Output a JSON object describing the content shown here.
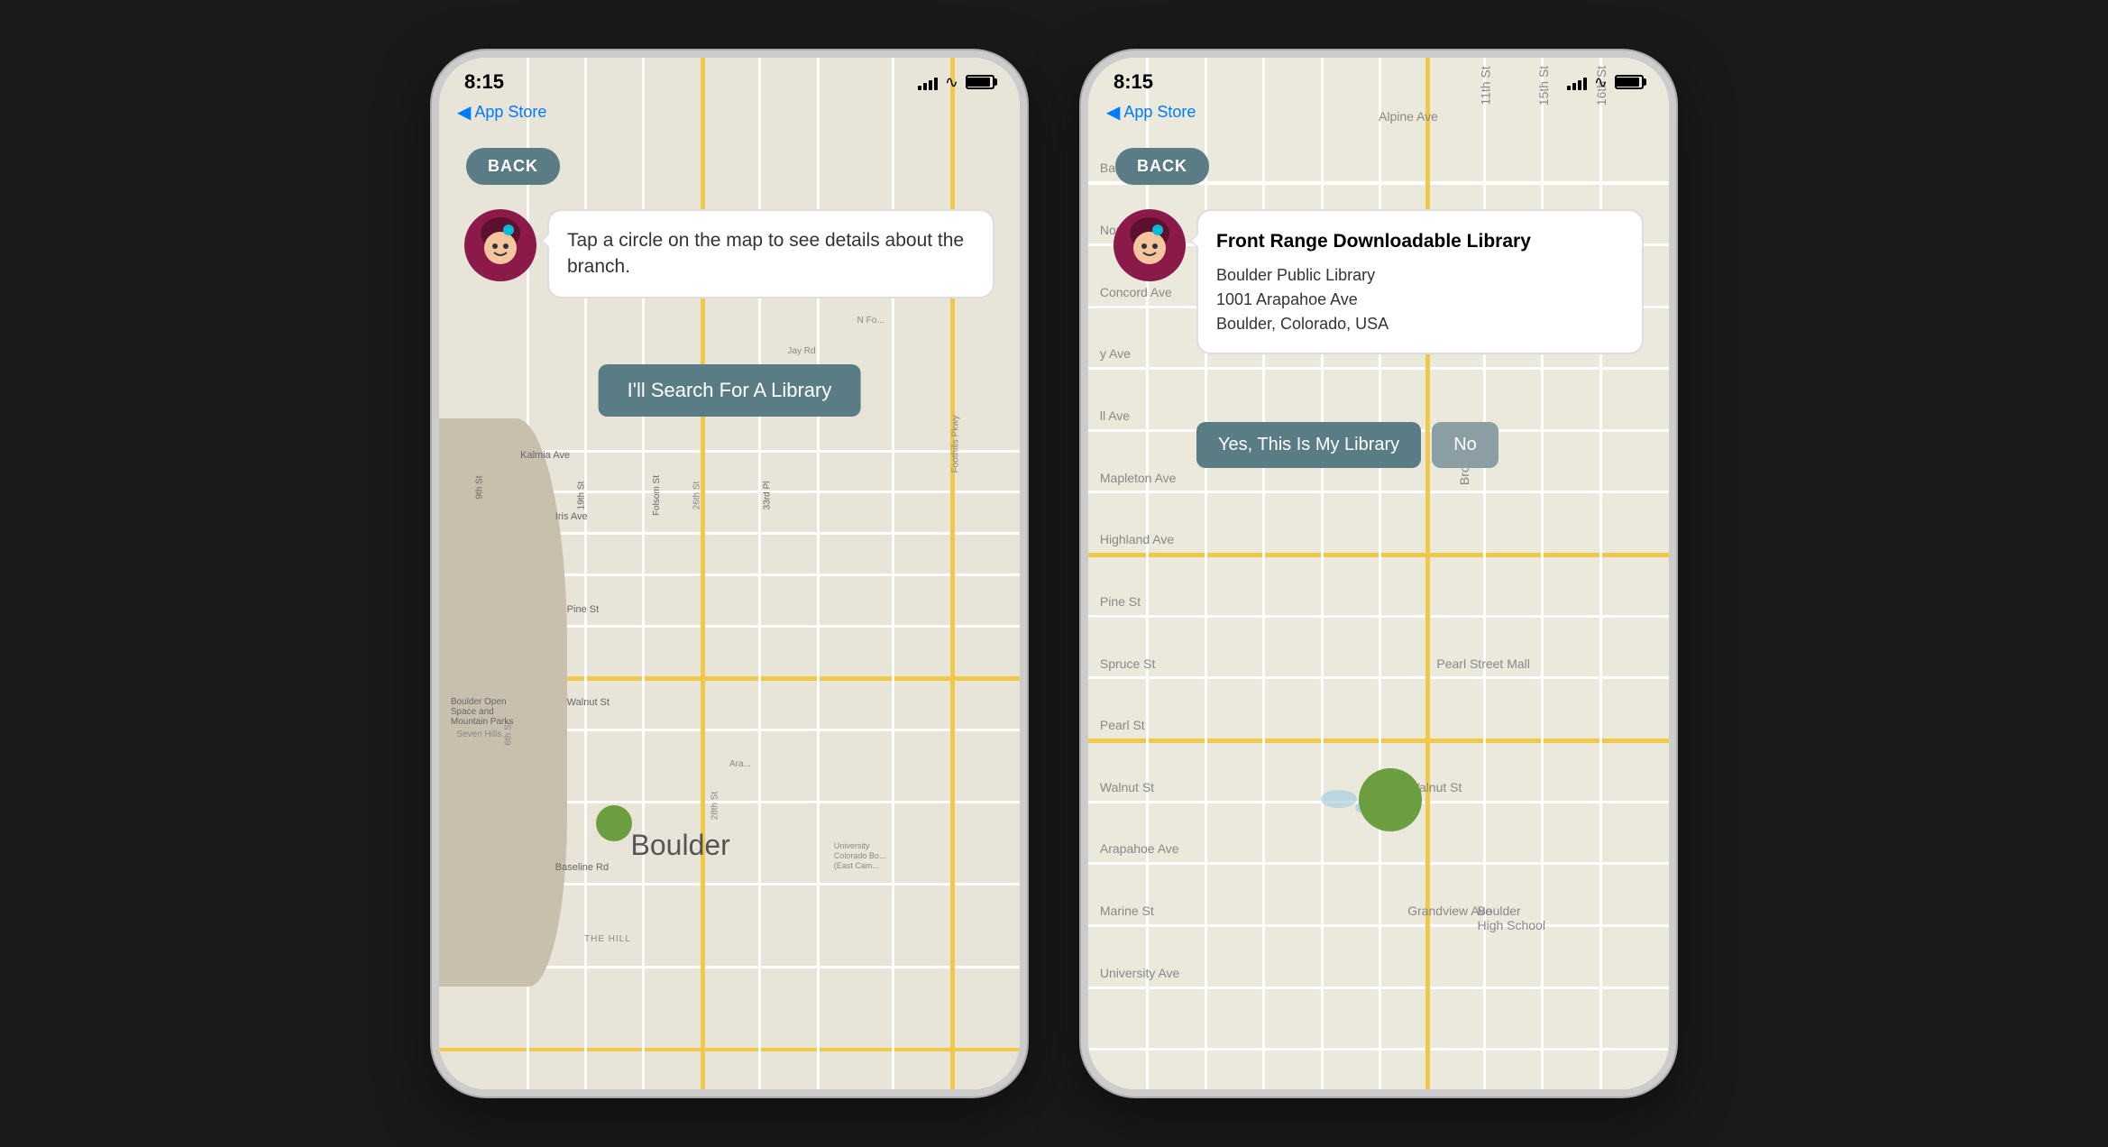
{
  "phone1": {
    "status": {
      "time": "8:15",
      "nav_back": "App Store"
    },
    "back_button": "BACK",
    "avatar_alt": "character avatar",
    "bubble_text": "Tap a circle on the map to see details about the branch.",
    "search_button": "I'll Search For A Library",
    "map": {
      "city_label": "Boulder",
      "terrain_label": "Boulder Open Space and Mountain Parks",
      "hill_label": "Seven Hills",
      "the_hill_label": "THE HILL",
      "roads": [
        "N Fo...",
        "28th",
        "Kalmia Ave",
        "Iris Ave",
        "Pine St",
        "Walnut St",
        "Baseline Rd",
        "9th St",
        "19th St",
        "Folsom St",
        "33rd Pl",
        "26th St",
        "Foothills Pkwy",
        "6th St",
        "28th St",
        "Arapahoe Ave"
      ]
    }
  },
  "phone2": {
    "status": {
      "time": "8:15",
      "nav_back": "App Store"
    },
    "back_button": "BACK",
    "avatar_alt": "character avatar",
    "library": {
      "name": "Front Range Downloadable Library",
      "system": "Boulder Public Library",
      "address": "1001 Arapahoe Ave",
      "city": "Boulder, Colorado, USA"
    },
    "yes_button": "Yes, This Is My Library",
    "no_button": "No",
    "map": {
      "streets": [
        "Balsam Ave",
        "Alpine Ave",
        "North St",
        "Concord Ave",
        "Mapleton Ave",
        "Highland Ave",
        "Pine St",
        "Spruce St",
        "Pearl St",
        "Walnut St",
        "Arapahoe Ave",
        "Marine St",
        "Grandview Ave",
        "University Ave",
        "11th St",
        "15th St",
        "16th St",
        "Broadway",
        "Pearl Street Mall",
        "Boulder High School"
      ]
    }
  },
  "icons": {
    "signal": "▌▌▌▌",
    "wifi": "WiFi",
    "battery": "Battery",
    "back_arrow": "◀"
  }
}
